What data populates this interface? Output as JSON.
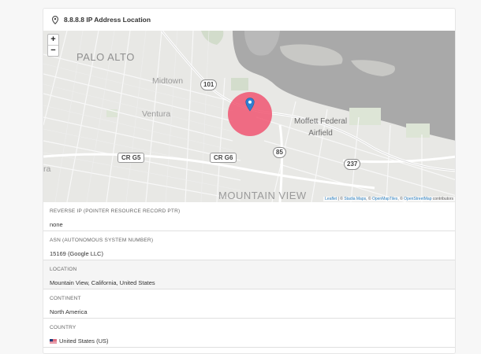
{
  "card": {
    "title": "8.8.8.8 IP Address Location"
  },
  "map": {
    "zoom_in": "+",
    "zoom_out": "−",
    "labels": {
      "palo_alto": "PALO ALTO",
      "midtown": "Midtown",
      "ventura": "Ventura",
      "moffett_1": "Moffett Federal",
      "moffett_2": "Airfield",
      "mountain_view": "MOUNTAIN VIEW",
      "edge_left": "ra"
    },
    "shields": {
      "us101": "101",
      "cr_g5": "CR G5",
      "cr_g6": "CR G6",
      "hw85": "85",
      "hw237": "237"
    },
    "attribution": {
      "leaflet": "Leaflet",
      "sep1": " | © ",
      "stadia": "Stadia Maps",
      "sep2": ", © ",
      "omt": "OpenMapTiles",
      "sep3": ", © ",
      "osm": "OpenStreetMap",
      "tail": " contributors"
    },
    "colors": {
      "circle": "#f04f6c",
      "marker": "#2f7fd1",
      "water": "#a9a9a9"
    }
  },
  "fields": [
    {
      "label": "REVERSE IP (POINTER RESOURCE RECORD PTR)",
      "value": "none"
    },
    {
      "label": "ASN (AUTONOMOUS SYSTEM NUMBER)",
      "value": "15169 (Google LLC)"
    },
    {
      "label": "LOCATION",
      "value": "Mountain View, California, United States"
    },
    {
      "label": "CONTINENT",
      "value": "North America"
    },
    {
      "label": "COUNTRY",
      "value": "United States (US)"
    }
  ]
}
